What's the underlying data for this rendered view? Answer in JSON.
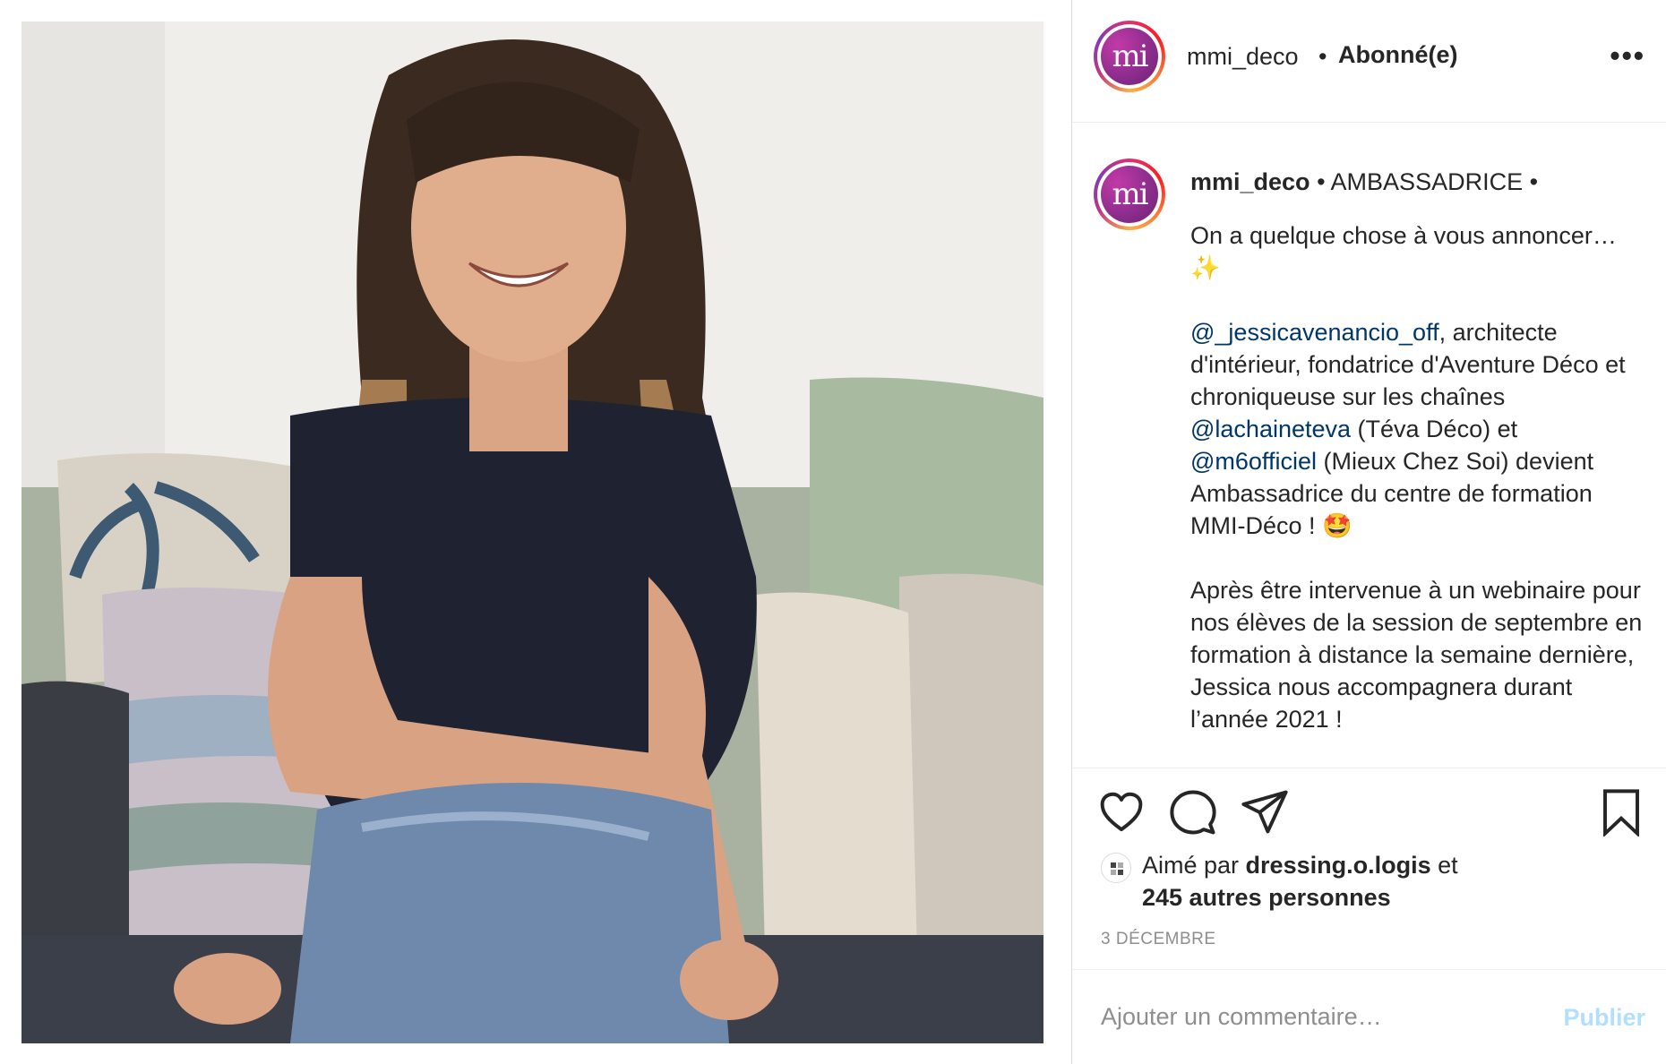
{
  "post": {
    "image_alt": "photo",
    "colors": {
      "link": "#00376b",
      "muted": "#8e8e8e",
      "publish_disabled": "#b2dffc",
      "text": "#262626"
    }
  },
  "header": {
    "avatar_text": "mi",
    "username": "mmi_deco",
    "separator": "•",
    "follow_status": "Abonné(e)",
    "more_icon": "more-horizontal-icon"
  },
  "caption": {
    "avatar_text": "mi",
    "username": "mmi_deco",
    "intro": "• AMBASSADRICE •",
    "para1": "On a quelque chose à vous annoncer… ✨",
    "mention1": "@_jessicavenancio_off",
    "p2_text1": ", architecte d'intérieur, fondatrice d'Aventure Déco et chroniqueuse sur les chaînes ",
    "mention2": "@lachaineteva",
    "p2_text2": " (Téva Déco) et ",
    "mention3": "@m6officiel",
    "p2_text3": " (Mieux Chez Soi) devient Ambassadrice du centre de formation MMI-Déco ! 🤩",
    "para3": "Après être intervenue à un webinaire pour nos élèves de la session de septembre en formation à distance la semaine dernière, Jessica nous accompagnera durant l’année 2021 !"
  },
  "actions": {
    "like_icon": "heart-icon",
    "comment_icon": "comment-icon",
    "share_icon": "paper-plane-icon",
    "save_icon": "bookmark-icon"
  },
  "likes": {
    "prefix": "Aimé par ",
    "user": "dressing.o.logis",
    "middle": " et",
    "others": "245 autres personnes"
  },
  "date": "3 DÉCEMBRE",
  "comment": {
    "placeholder": "Ajouter un commentaire…",
    "publish_label": "Publier"
  }
}
